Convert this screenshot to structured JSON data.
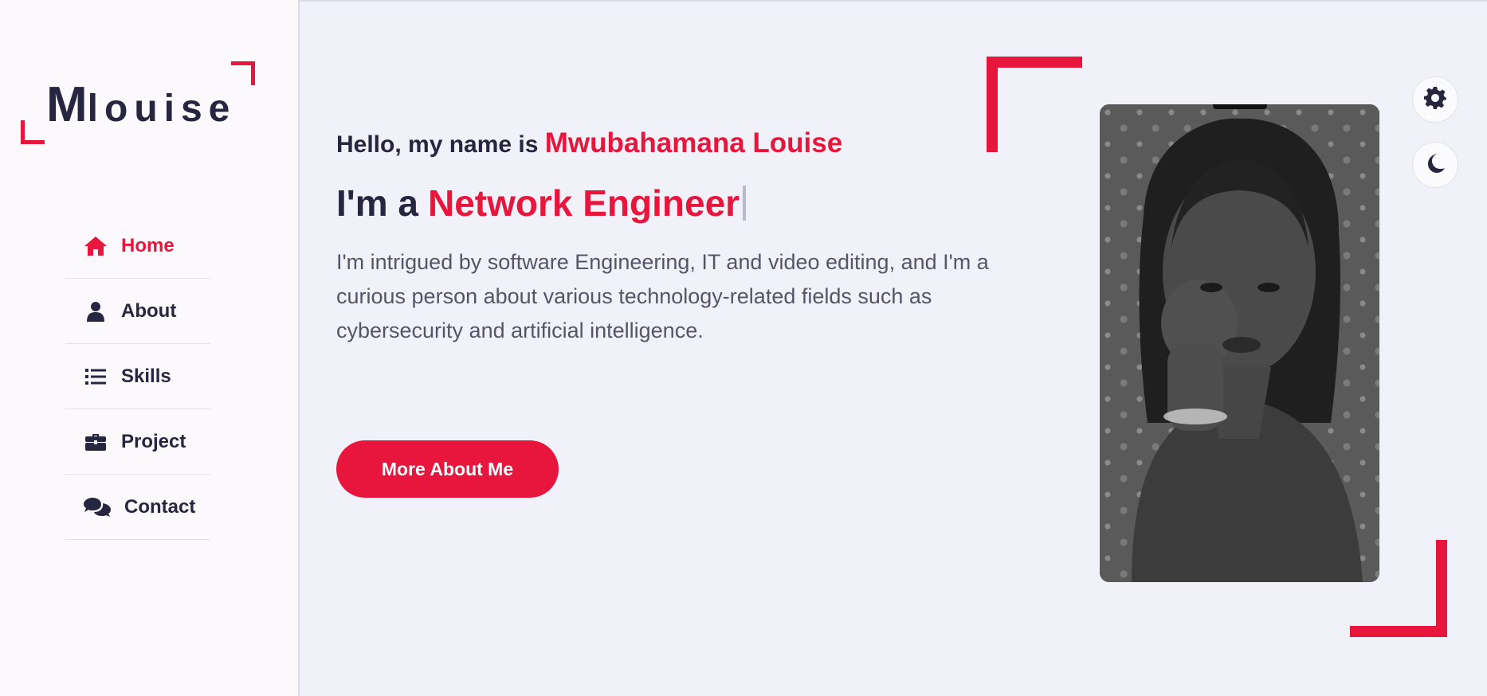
{
  "logo": {
    "first_letter": "M",
    "rest": "louise"
  },
  "nav": {
    "items": [
      {
        "label": "Home",
        "icon": "home-icon",
        "active": true
      },
      {
        "label": "About",
        "icon": "user-icon",
        "active": false
      },
      {
        "label": "Skills",
        "icon": "list-icon",
        "active": false
      },
      {
        "label": "Project",
        "icon": "briefcase-icon",
        "active": false
      },
      {
        "label": "Contact",
        "icon": "chat-bubbles-icon",
        "active": false
      }
    ]
  },
  "hero": {
    "greeting_prefix": "Hello, my name is",
    "name": "Mwubahamana Louise",
    "role_prefix": "I'm a",
    "role": "Network Engineer",
    "description": "I'm intrigued by software Engineering, IT and video editing, and I'm a curious person about various technology-related fields such as cybersecurity and artificial intelligence.",
    "cta_label": "More About Me"
  },
  "controls": {
    "settings_icon": "gear-icon",
    "theme_icon": "moon-icon"
  },
  "colors": {
    "accent": "#e8163c",
    "text_dark": "#262640",
    "background": "#f1f1f9",
    "sidebar": "#fcf9fd"
  }
}
